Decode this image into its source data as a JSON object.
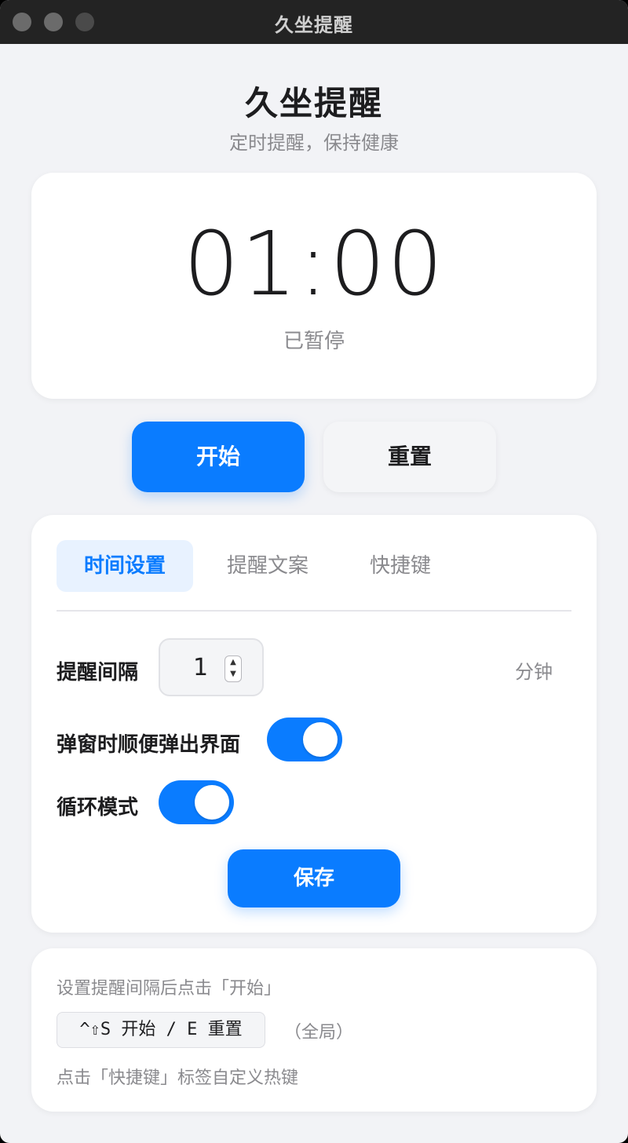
{
  "window": {
    "title": "久坐提醒"
  },
  "header": {
    "title": "久坐提醒",
    "subtitle": "定时提醒，保持健康"
  },
  "timer": {
    "display": "01:00",
    "status": "已暂停"
  },
  "controls": {
    "start_label": "开始",
    "reset_label": "重置"
  },
  "tabs": [
    {
      "label": "时间设置",
      "active": true
    },
    {
      "label": "提醒文案",
      "active": false
    },
    {
      "label": "快捷键",
      "active": false
    }
  ],
  "settings": {
    "interval_label": "提醒间隔",
    "interval_value": "1",
    "interval_unit": "分钟",
    "popup_label": "弹窗时顺便弹出界面",
    "popup_enabled": true,
    "loop_label": "循环模式",
    "loop_enabled": true,
    "save_label": "保存"
  },
  "help": {
    "line1": "设置提醒间隔后点击「开始」",
    "shortcut": "^⇧S 开始 / E 重置",
    "shortcut_scope": "（全局）",
    "line3": "点击「快捷键」标签自定义热键"
  },
  "colors": {
    "accent": "#0a7cff",
    "background": "#f2f3f6",
    "titlebar": "#232323"
  }
}
